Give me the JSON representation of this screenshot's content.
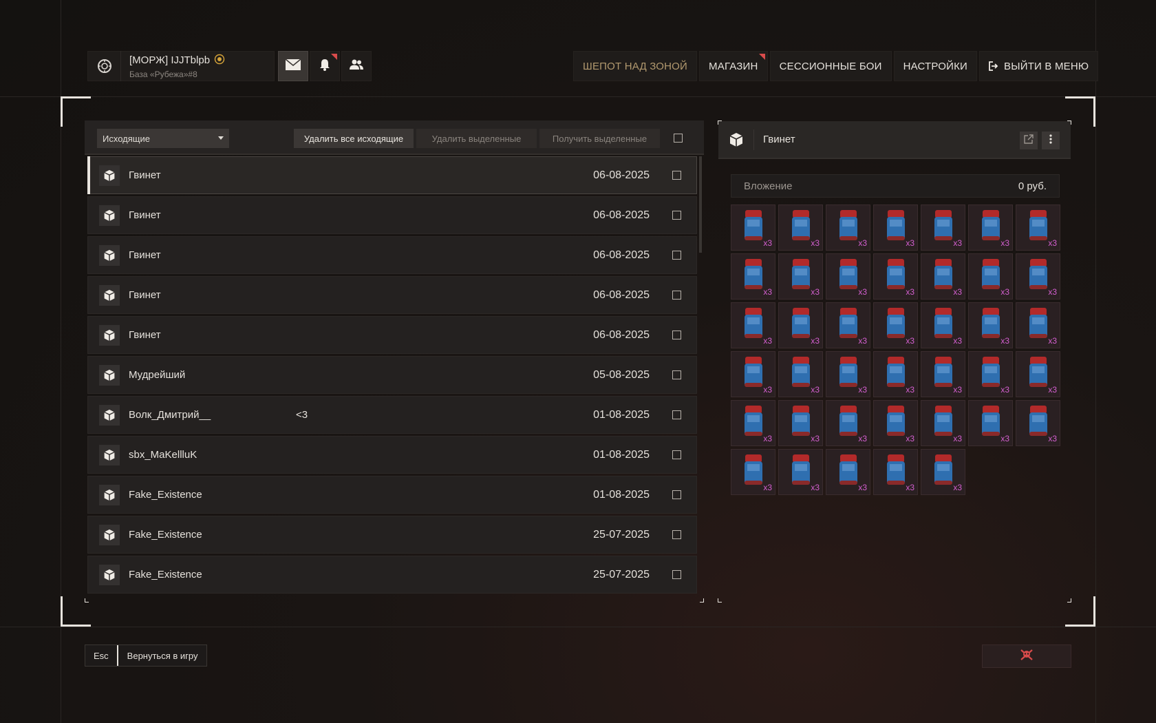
{
  "profile": {
    "nickname": "[МОРЖ] IJJTblpb",
    "base": "База «Рубежа»#8"
  },
  "nav": {
    "whisper": "ШЕПОТ НАД ЗОНОЙ",
    "shop": "МАГАЗИН",
    "session_fights": "СЕССИОННЫЕ БОИ",
    "settings": "НАСТРОЙКИ",
    "exit": "ВЫЙТИ В МЕНЮ"
  },
  "mail": {
    "folder": "Исходящие",
    "delete_all": "Удалить все исходящие",
    "delete_selected": "Удалить выделенные",
    "receive_selected": "Получить выделенные",
    "rows": [
      {
        "sender": "Гвинет",
        "subject": "",
        "date": "06-08-2025"
      },
      {
        "sender": "Гвинет",
        "subject": "",
        "date": "06-08-2025"
      },
      {
        "sender": "Гвинет",
        "subject": "",
        "date": "06-08-2025"
      },
      {
        "sender": "Гвинет",
        "subject": "",
        "date": "06-08-2025"
      },
      {
        "sender": "Гвинет",
        "subject": "",
        "date": "06-08-2025"
      },
      {
        "sender": "Мудрейший",
        "subject": "",
        "date": "05-08-2025"
      },
      {
        "sender": "Волк_Дмитрий__",
        "subject": "<3",
        "date": "01-08-2025"
      },
      {
        "sender": "sbx_MaKellluK",
        "subject": "",
        "date": "01-08-2025"
      },
      {
        "sender": "Fake_Existence",
        "subject": "",
        "date": "01-08-2025"
      },
      {
        "sender": "Fake_Existence",
        "subject": "",
        "date": "25-07-2025"
      },
      {
        "sender": "Fake_Existence",
        "subject": "",
        "date": "25-07-2025"
      }
    ]
  },
  "detail": {
    "title": "Гвинет",
    "attachment_label": "Вложение",
    "attachment_value": "0 руб.",
    "item_qty": "x3",
    "item_count": 40
  },
  "bottom": {
    "esc_key": "Esc",
    "back_label": "Вернуться в игру"
  },
  "colors": {
    "accent_gold": "#b39a6f",
    "notify_red": "#d84b4b",
    "qty_magenta": "#d45fd0"
  }
}
